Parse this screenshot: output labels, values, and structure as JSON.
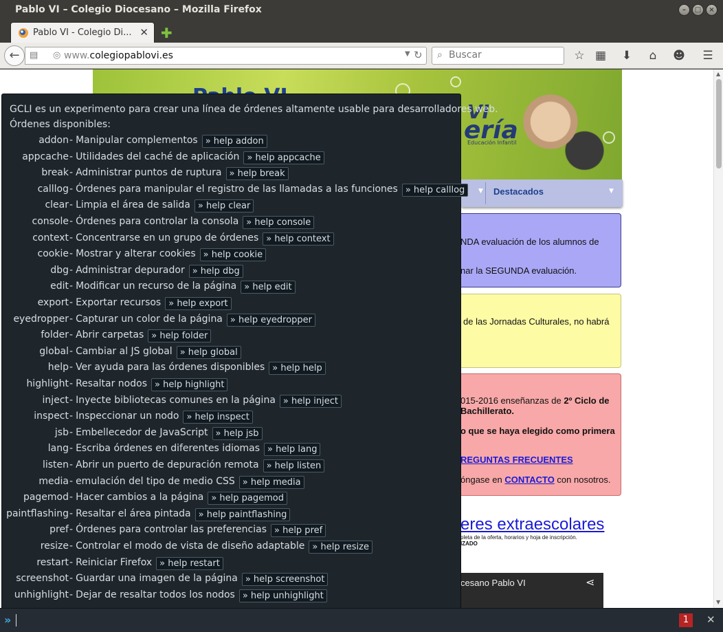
{
  "window": {
    "title": "Pablo VI – Colegio Diocesano – Mozilla Firefox"
  },
  "tab": {
    "label": "Pablo VI - Colegio Di...",
    "close": "✕",
    "new_tab": "✚"
  },
  "navbar": {
    "url_prefix": "www.",
    "url_domain": "colegiopablovi.es",
    "search_placeholder": "Buscar"
  },
  "page": {
    "banner": {
      "logo_text": "Pablo VI",
      "vi": "VI",
      "eria": "ería",
      "subtitle": "Educación Infantil"
    },
    "nav": {
      "destacados": "Destacados"
    },
    "notices": [
      {
        "line1": "NDA evaluación de los alumnos de",
        "line2": "nar la SEGUNDA evaluación."
      },
      {
        "line1": "de las Jornadas Culturales, no habrá"
      },
      {
        "line1_start": "015-2016 enseñanzas de ",
        "line1_bold": "2º Ciclo de",
        "line2": "Bachillerato.",
        "line3": "o que se haya elegido como primera",
        "link_faq": "REGUNTAS FRECUENTES",
        "line5_start": "óngase en ",
        "link_contact": "CONTACTO",
        "line5_end": " con nosotros."
      }
    ],
    "extracurricular": {
      "title": "eres extraescolares",
      "small1": "pleta de la oferta, horarios y hoja de inscripción.",
      "small2": "IZADO"
    },
    "video_title": "cesano Pablo VI"
  },
  "gcli": {
    "intro1": "GCLI es un experimento para crear una línea de órdenes altamente usable para desarrolladores web.",
    "intro2": "Órdenes disponibles:",
    "commands": [
      {
        "name": "addon",
        "desc": "Manipular complementos",
        "help": "help addon"
      },
      {
        "name": "appcache",
        "desc": "Utilidades del caché de aplicación",
        "help": "help appcache"
      },
      {
        "name": "break",
        "desc": "Administrar puntos de ruptura",
        "help": "help break"
      },
      {
        "name": "calllog",
        "desc": "Órdenes para manipular el registro de las llamadas a las funciones",
        "help": "help calllog"
      },
      {
        "name": "clear",
        "desc": "Limpia el área de salida",
        "help": "help clear"
      },
      {
        "name": "console",
        "desc": "Órdenes para controlar la consola",
        "help": "help console"
      },
      {
        "name": "context",
        "desc": "Concentrarse en un grupo de órdenes",
        "help": "help context"
      },
      {
        "name": "cookie",
        "desc": "Mostrar y alterar cookies",
        "help": "help cookie"
      },
      {
        "name": "dbg",
        "desc": "Administrar depurador",
        "help": "help dbg"
      },
      {
        "name": "edit",
        "desc": "Modificar un recurso de la página",
        "help": "help edit"
      },
      {
        "name": "export",
        "desc": "Exportar recursos",
        "help": "help export"
      },
      {
        "name": "eyedropper",
        "desc": "Capturar un color de la página",
        "help": "help eyedropper"
      },
      {
        "name": "folder",
        "desc": "Abrir carpetas",
        "help": "help folder"
      },
      {
        "name": "global",
        "desc": "Cambiar al JS global",
        "help": "help global"
      },
      {
        "name": "help",
        "desc": "Ver ayuda para las órdenes disponibles",
        "help": "help help"
      },
      {
        "name": "highlight",
        "desc": "Resaltar nodos",
        "help": "help highlight"
      },
      {
        "name": "inject",
        "desc": "Inyecte bibliotecas comunes en la página",
        "help": "help inject"
      },
      {
        "name": "inspect",
        "desc": "Inspeccionar un nodo",
        "help": "help inspect"
      },
      {
        "name": "jsb",
        "desc": "Embellecedor de JavaScript",
        "help": "help jsb"
      },
      {
        "name": "lang",
        "desc": "Escriba órdenes en diferentes idiomas",
        "help": "help lang"
      },
      {
        "name": "listen",
        "desc": "Abrir un puerto de depuración remota",
        "help": "help listen"
      },
      {
        "name": "media",
        "desc": "emulación del tipo de medio CSS",
        "help": "help media"
      },
      {
        "name": "pagemod",
        "desc": "Hacer cambios a la página",
        "help": "help pagemod"
      },
      {
        "name": "paintflashing",
        "desc": "Resaltar el área pintada",
        "help": "help paintflashing"
      },
      {
        "name": "pref",
        "desc": "Órdenes para controlar las preferencias",
        "help": "help pref"
      },
      {
        "name": "resize",
        "desc": "Controlar el modo de vista de diseño adaptable",
        "help": "help resize"
      },
      {
        "name": "restart",
        "desc": "Reiniciar Firefox",
        "help": "help restart"
      },
      {
        "name": "screenshot",
        "desc": "Guardar una imagen de la página",
        "help": "help screenshot"
      },
      {
        "name": "unhighlight",
        "desc": "Dejar de resaltar todos los nodos",
        "help": "help unhighlight"
      }
    ]
  },
  "cmdbar": {
    "prompt": "»",
    "error_count": "1",
    "close": "✕"
  },
  "colors": {
    "accent": "#3fa8dc",
    "error": "#b72424",
    "panel_bg": "#1e262c"
  },
  "icons": [
    "back-arrow-icon",
    "history-icon",
    "globe-icon",
    "reload-icon",
    "search-icon",
    "bookmark-star-icon",
    "reading-list-icon",
    "download-icon",
    "home-icon",
    "chat-icon",
    "menu-icon",
    "share-icon"
  ]
}
